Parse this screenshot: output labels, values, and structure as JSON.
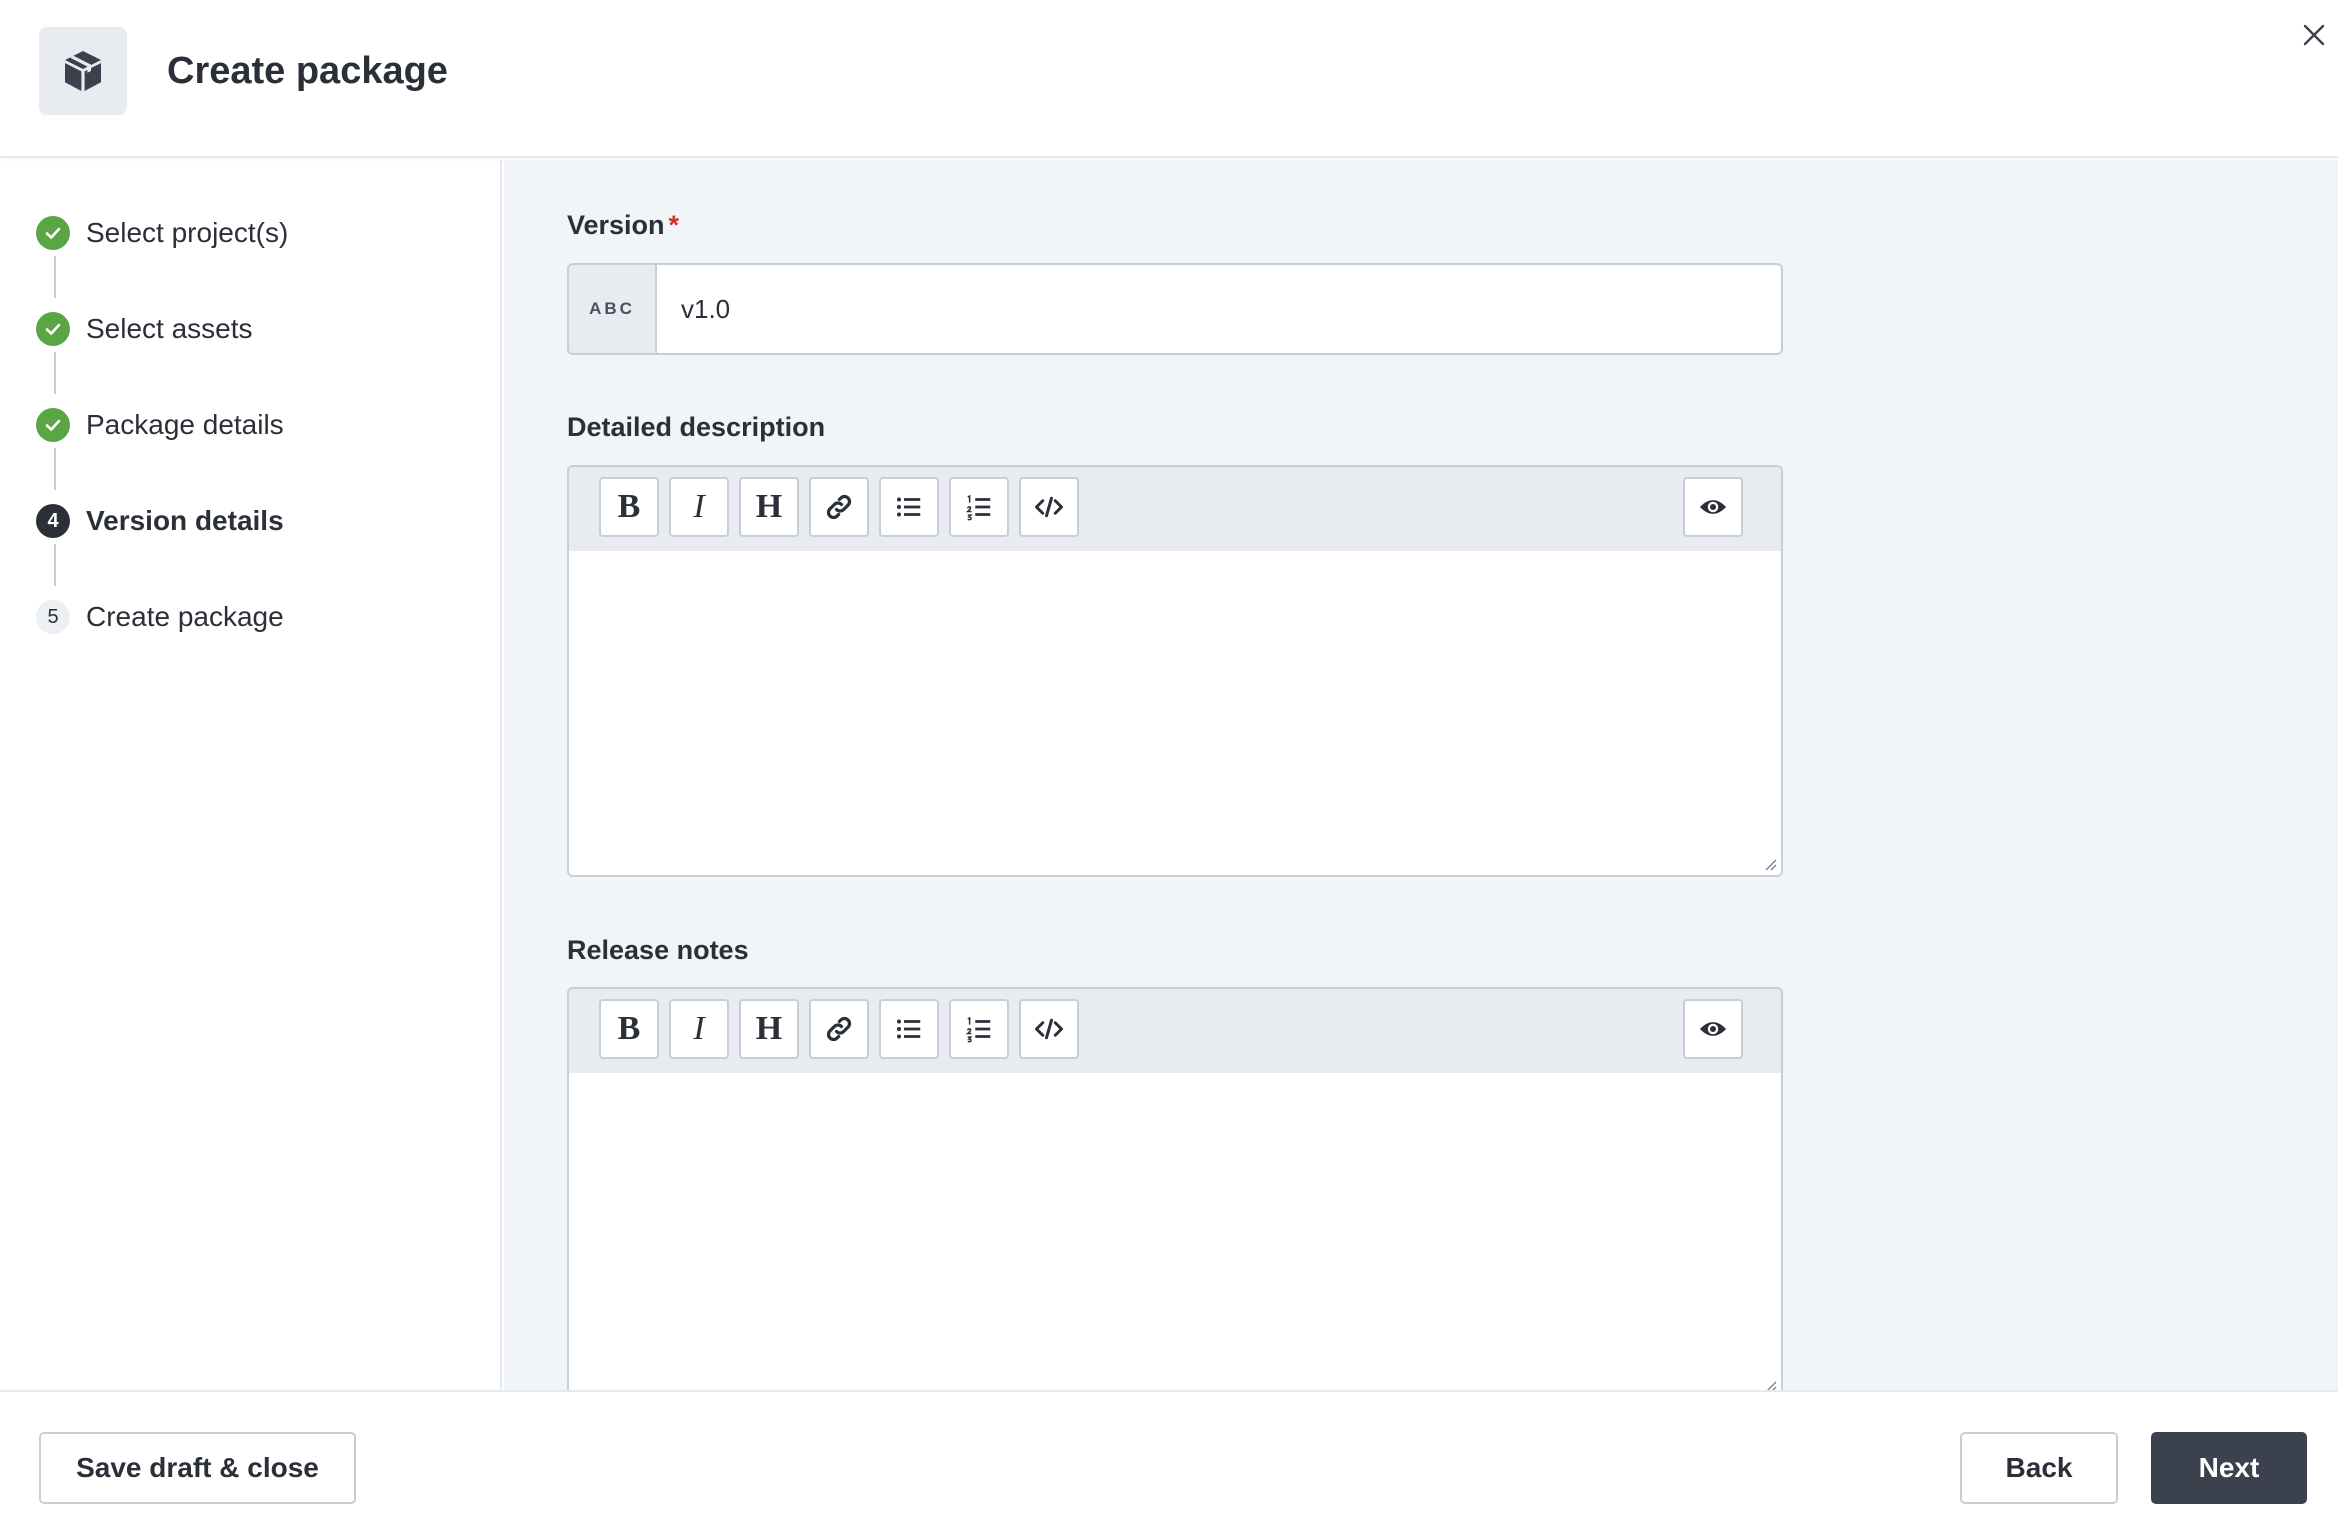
{
  "header": {
    "title": "Create package",
    "icon": "package-box-icon",
    "close_icon": "close-icon"
  },
  "steps": [
    {
      "number": "1",
      "label": "Select project(s)",
      "status": "done"
    },
    {
      "number": "2",
      "label": "Select assets",
      "status": "done"
    },
    {
      "number": "3",
      "label": "Package details",
      "status": "done"
    },
    {
      "number": "4",
      "label": "Version details",
      "status": "current"
    },
    {
      "number": "5",
      "label": "Create package",
      "status": "todo"
    }
  ],
  "form": {
    "version": {
      "label": "Version",
      "required_mark": "*",
      "prefix": "ABC",
      "value": "v1.0"
    },
    "description": {
      "label": "Detailed description",
      "value": ""
    },
    "release_notes": {
      "label": "Release notes",
      "value": ""
    }
  },
  "toolbar": {
    "bold": "B",
    "italic": "I",
    "heading": "H",
    "icons": [
      "bold-icon",
      "italic-icon",
      "heading-icon",
      "link-icon",
      "bullet-list-icon",
      "numbered-list-icon",
      "code-icon",
      "preview-eye-icon"
    ]
  },
  "footer": {
    "save_draft_label": "Save draft & close",
    "back_label": "Back",
    "next_label": "Next"
  },
  "colors": {
    "success": "#5aa544",
    "primary_button": "#3c424d",
    "required": "#d0312d",
    "panel_background": "#f2f5f8"
  }
}
